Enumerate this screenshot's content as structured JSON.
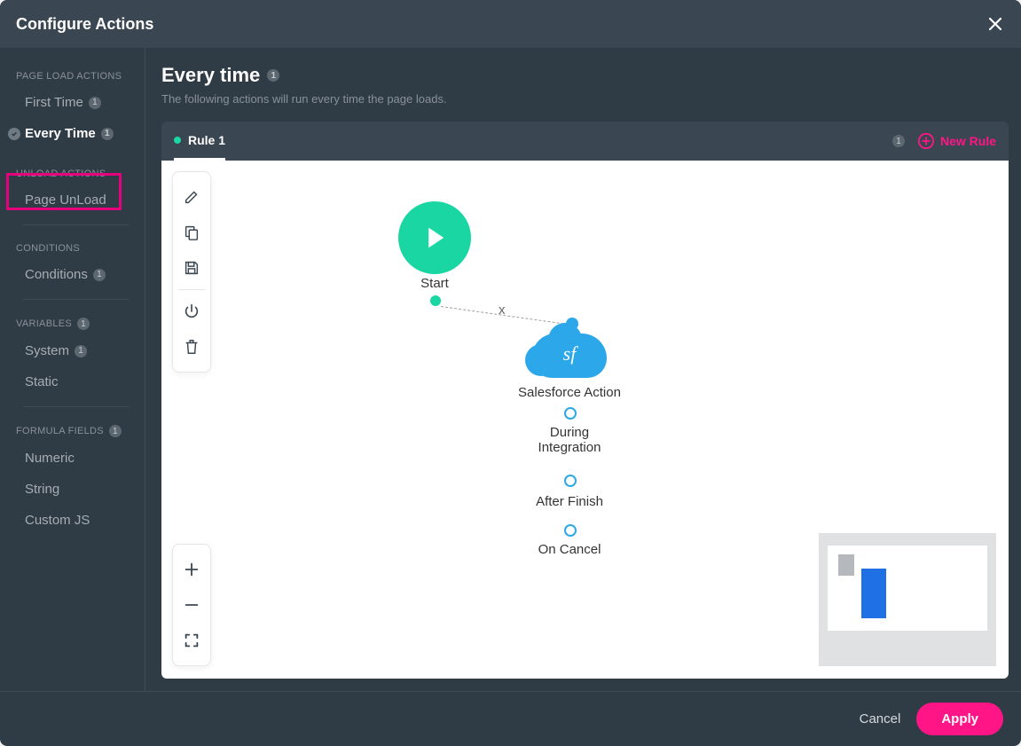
{
  "modal": {
    "title": "Configure Actions"
  },
  "sidebar": {
    "groups": [
      {
        "label": "PAGE LOAD ACTIONS",
        "items": [
          {
            "label": "First Time",
            "badge": "1",
            "active": false
          },
          {
            "label": "Every Time",
            "badge": "1",
            "active": true
          }
        ]
      },
      {
        "label": "UNLOAD ACTIONS",
        "items": [
          {
            "label": "Page UnLoad",
            "badge": "",
            "active": false
          }
        ]
      },
      {
        "label": "CONDITIONS",
        "items": [
          {
            "label": "Conditions",
            "badge": "1",
            "active": false
          }
        ]
      },
      {
        "label": "VARIABLES",
        "label_badge": "1",
        "items": [
          {
            "label": "System",
            "badge": "1",
            "active": false
          },
          {
            "label": "Static",
            "badge": "",
            "active": false
          }
        ]
      },
      {
        "label": "FORMULA FIELDS",
        "label_badge": "1",
        "items": [
          {
            "label": "Numeric",
            "badge": "",
            "active": false
          },
          {
            "label": "String",
            "badge": "",
            "active": false
          },
          {
            "label": "Custom JS",
            "badge": "",
            "active": false
          }
        ]
      }
    ]
  },
  "page": {
    "title": "Every time",
    "title_badge": "1",
    "subtitle": "The following actions will run every time the page loads."
  },
  "rules": {
    "tabs": [
      {
        "label": "Rule 1"
      }
    ],
    "count_badge": "1",
    "new_rule_label": "New Rule"
  },
  "flow": {
    "start_label": "Start",
    "edge_x": "x",
    "sf_glyph": "sf",
    "sf_label": "Salesforce Action",
    "slot1_a": "During",
    "slot1_b": "Integration",
    "slot2": "After Finish",
    "slot3": "On Cancel"
  },
  "footer": {
    "cancel": "Cancel",
    "apply": "Apply"
  }
}
